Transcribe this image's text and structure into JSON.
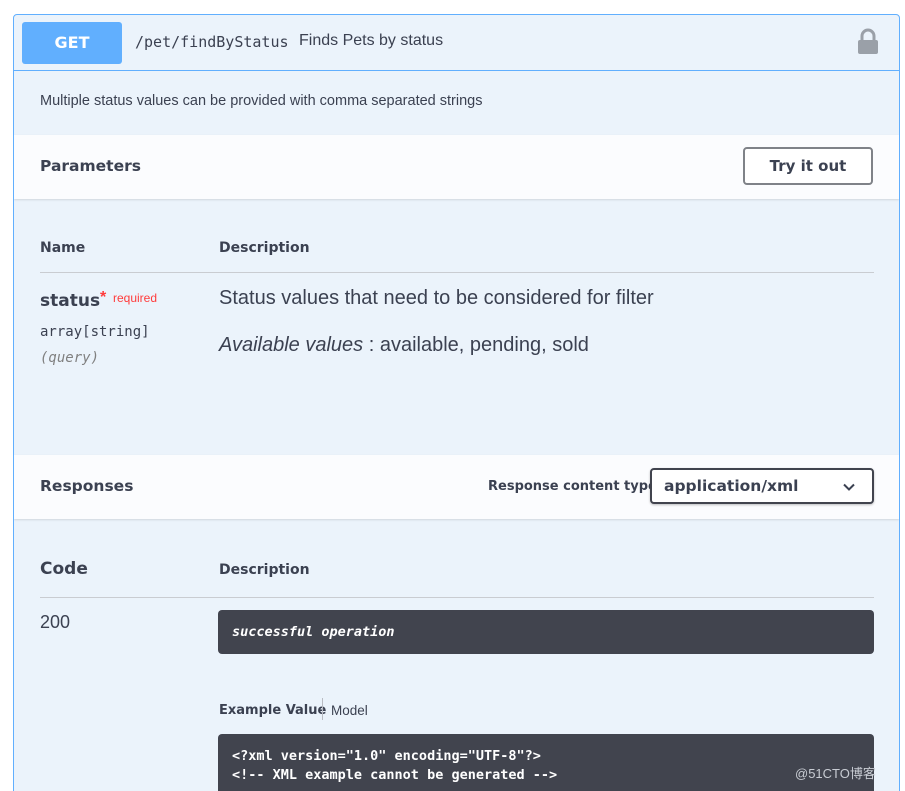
{
  "operation": {
    "method": "GET",
    "path": "/pet/findByStatus",
    "summary": "Finds Pets by status",
    "description": "Multiple status values can be provided with comma separated strings"
  },
  "parameters": {
    "title": "Parameters",
    "try_button": "Try it out",
    "col_name": "Name",
    "col_description": "Description",
    "items": [
      {
        "name": "status",
        "required_mark": "*",
        "required_label": "required",
        "type": "array[string]",
        "in": "(query)",
        "description": "Status values that need to be considered for filter",
        "available_label": "Available values",
        "available_values": ": available, pending, sold"
      }
    ]
  },
  "responses": {
    "title": "Responses",
    "content_type_label": "Response content type",
    "content_type_value": "application/xml",
    "col_code": "Code",
    "col_description": "Description",
    "items": [
      {
        "code": "200",
        "description": "successful operation",
        "example_tab": "Example Value",
        "model_tab": "Model",
        "example_lines": [
          "<?xml version=\"1.0\" encoding=\"UTF-8\"?>",
          "<!-- XML example cannot be generated -->"
        ]
      }
    ]
  },
  "watermark": "@51CTO博客",
  "colors": {
    "get_accent": "#61affe",
    "panel_bg": "#ebf3fb",
    "dark_box": "#41444e",
    "required": "#ff3b3b"
  }
}
